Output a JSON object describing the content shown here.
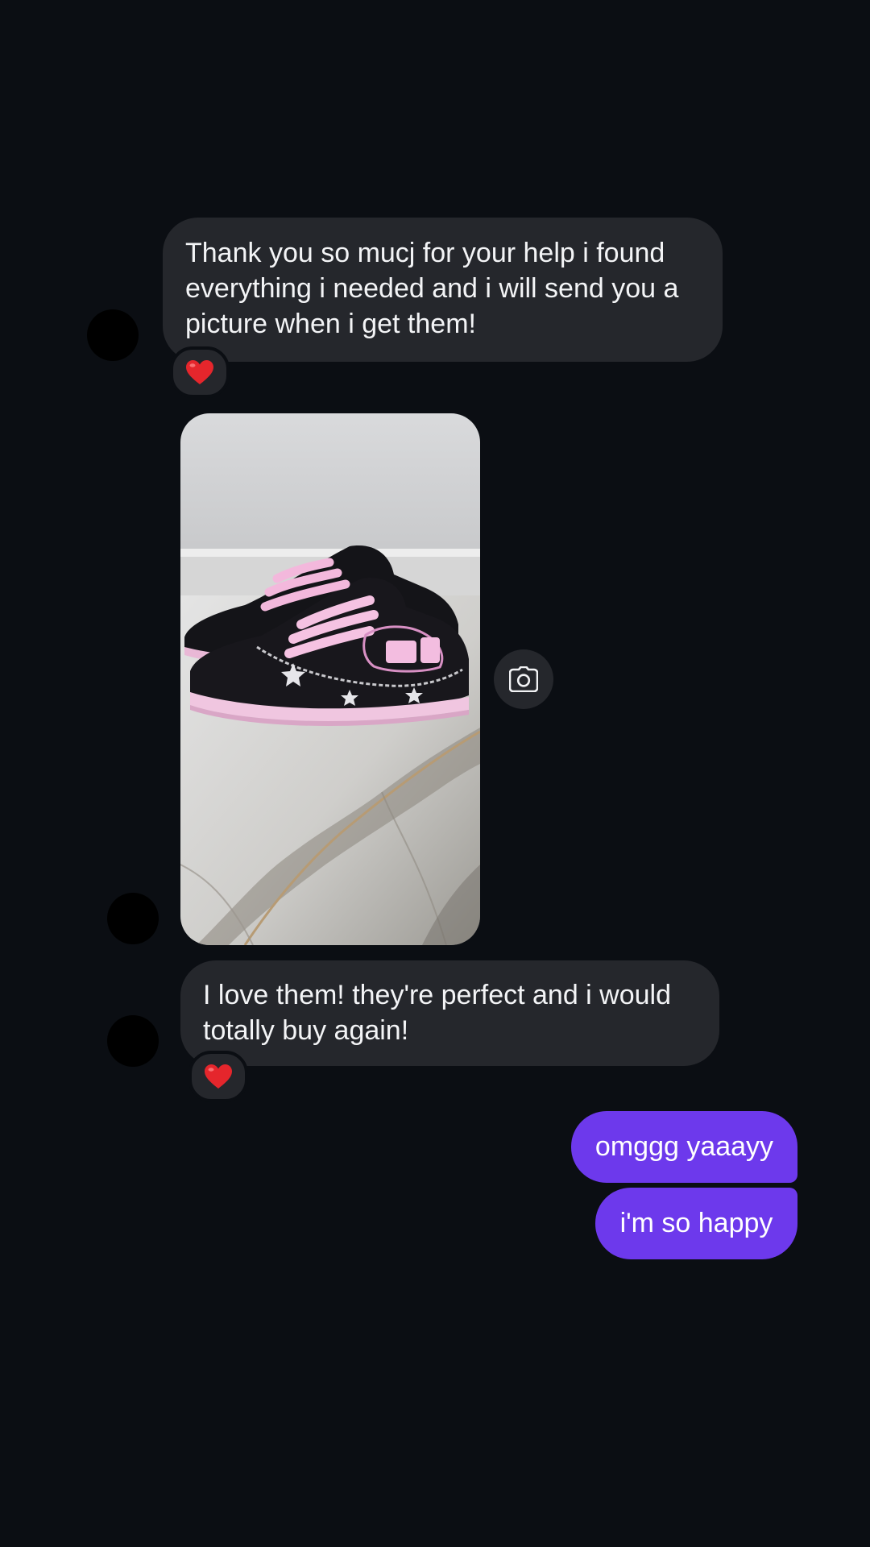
{
  "colors": {
    "background": "#0b0e13",
    "incoming_bubble": "#25272c",
    "outgoing_bubble": "#6d39ec",
    "text": "#f3f4f6"
  },
  "messages": {
    "first": {
      "text": "Thank you so mucj for your help i found everything i needed and i will send you a picture when i get them!",
      "reaction": "heart-icon"
    },
    "photo": {
      "icon": "camera-icon"
    },
    "second": {
      "text": "I love them! they're perfect and i would totally buy again!",
      "reaction": "heart-icon"
    },
    "outgoing": [
      {
        "text": "omggg yaaayy"
      },
      {
        "text": "i'm so happy"
      }
    ]
  }
}
